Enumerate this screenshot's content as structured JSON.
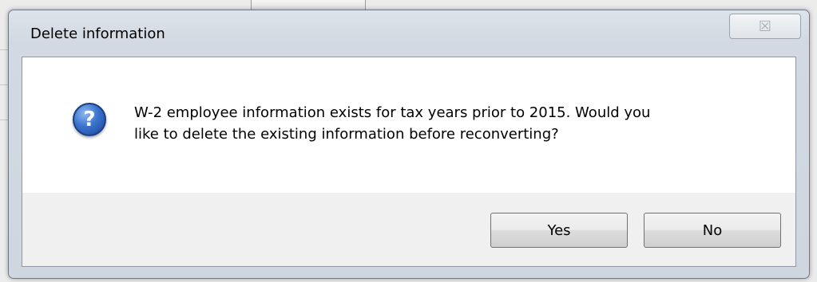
{
  "dialog": {
    "title": "Delete information",
    "close_symbol": "☒",
    "message_line1": "W-2 employee information exists for tax years prior to 2015.  Would you",
    "message_line2": "like to delete the existing information before reconverting?",
    "icon": "question-icon",
    "icon_glyph": "?",
    "buttons": {
      "yes_label": "Yes",
      "no_label": "No"
    }
  },
  "colors": {
    "icon_blue": "#2f63b8",
    "title_frame": "#d2d9e2"
  }
}
